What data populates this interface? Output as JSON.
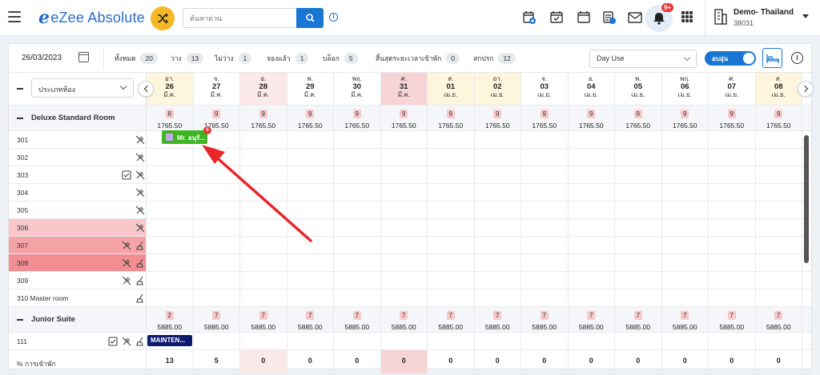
{
  "app": {
    "logo": "eZee Absolute",
    "search_placeholder": "ค้นหาด่วน",
    "notif_badge": "9+",
    "property_name": "Demo- Thailand",
    "property_code": "38031"
  },
  "filter": {
    "date": "26/03/2023",
    "stats": [
      {
        "label": "ทั้งหมด",
        "count": "20"
      },
      {
        "label": "ว่าง",
        "count": "13"
      },
      {
        "label": "ไม่ว่าง",
        "count": "1"
      },
      {
        "label": "จองแล้ว",
        "count": "1"
      },
      {
        "label": "บล็อก",
        "count": "5"
      },
      {
        "label": "สิ้นสุดระยะเวลาเข้าพัก",
        "count": "0"
      },
      {
        "label": "สกปรก",
        "count": "12"
      }
    ],
    "dayuse": "Day Use",
    "toggle_label": "อบอุ่น"
  },
  "grid": {
    "room_type_select": "ประเภทห้อง",
    "days": [
      {
        "dw": "อา.",
        "dn": "26",
        "dm": "มี.ค.",
        "bg": "#fdf5dc"
      },
      {
        "dw": "จ.",
        "dn": "27",
        "dm": "มี.ค.",
        "bg": "#ffffff"
      },
      {
        "dw": "อ.",
        "dn": "28",
        "dm": "มี.ค.",
        "bg": "#fbe9ea"
      },
      {
        "dw": "พ.",
        "dn": "29",
        "dm": "มี.ค.",
        "bg": "#ffffff"
      },
      {
        "dw": "พฤ.",
        "dn": "30",
        "dm": "มี.ค.",
        "bg": "#ffffff"
      },
      {
        "dw": "ศ.",
        "dn": "31",
        "dm": "มี.ค.",
        "bg": "#f7d4d6"
      },
      {
        "dw": "ส.",
        "dn": "01",
        "dm": "เม.ย.",
        "bg": "#fdf5dc"
      },
      {
        "dw": "อา.",
        "dn": "02",
        "dm": "เม.ย.",
        "bg": "#fdf5dc"
      },
      {
        "dw": "จ.",
        "dn": "03",
        "dm": "เม.ย.",
        "bg": "#ffffff"
      },
      {
        "dw": "อ.",
        "dn": "04",
        "dm": "เม.ย.",
        "bg": "#ffffff"
      },
      {
        "dw": "พ.",
        "dn": "05",
        "dm": "เม.ย.",
        "bg": "#ffffff"
      },
      {
        "dw": "พฤ.",
        "dn": "06",
        "dm": "เม.ย.",
        "bg": "#ffffff"
      },
      {
        "dw": "ศ.",
        "dn": "07",
        "dm": "เม.ย.",
        "bg": "#ffffff"
      },
      {
        "dw": "ส.",
        "dn": "08",
        "dm": "เม.ย.",
        "bg": "#fdf5dc"
      }
    ],
    "categories": [
      {
        "name": "Deluxe Standard Room",
        "avail": [
          "8",
          "9",
          "9",
          "9",
          "9",
          "9",
          "9",
          "9",
          "9",
          "9",
          "9",
          "9",
          "9",
          "9"
        ],
        "rates": [
          "1765.50",
          "1765.50",
          "1765.50",
          "1765.50",
          "1765.50",
          "1765.50",
          "1765.50",
          "1765.50",
          "1765.50",
          "1765.50",
          "1765.50",
          "1765.50",
          "1765.50",
          "1765.50"
        ],
        "rooms": [
          {
            "name": "301",
            "bg": "#ffffff",
            "icons": [
              "dirty"
            ]
          },
          {
            "name": "302",
            "bg": "#ffffff",
            "icons": [
              "dirty"
            ]
          },
          {
            "name": "303",
            "bg": "#ffffff",
            "icons": [
              "check",
              "dirty"
            ]
          },
          {
            "name": "304",
            "bg": "#ffffff",
            "icons": [
              "dirty"
            ]
          },
          {
            "name": "305",
            "bg": "#ffffff",
            "icons": [
              "dirty"
            ]
          },
          {
            "name": "306",
            "bg": "#f9c7c9",
            "icons": [
              "dirty"
            ]
          },
          {
            "name": "307",
            "bg": "#f6a3a6",
            "icons": [
              "dirty",
              "broom"
            ]
          },
          {
            "name": "308",
            "bg": "#f28e92",
            "icons": [
              "dirty",
              "broom"
            ]
          },
          {
            "name": "309",
            "bg": "#ffffff",
            "icons": [
              "dirty",
              "broom"
            ]
          },
          {
            "name": "310 Master room",
            "bg": "#ffffff",
            "icons": [
              "broom"
            ]
          }
        ]
      },
      {
        "name": "Junior Suite",
        "avail": [
          "2",
          "7",
          "7",
          "7",
          "7",
          "7",
          "7",
          "7",
          "7",
          "7",
          "7",
          "7",
          "7",
          "7"
        ],
        "rates": [
          "5885.00",
          "5885.00",
          "5885.00",
          "5885.00",
          "5885.00",
          "5885.00",
          "5885.00",
          "5885.00",
          "5885.00",
          "5885.00",
          "5885.00",
          "5885.00",
          "5885.00",
          "5885.00"
        ],
        "rooms": [
          {
            "name": "111",
            "bg": "#ffffff",
            "icons": [
              "check",
              "dirty",
              "broom"
            ]
          }
        ]
      }
    ],
    "booking": {
      "label": "Mr. อนุรั...",
      "badge": "5"
    },
    "maintenance": "MAINTEN...",
    "occupancy": {
      "label": "% การเข้าพัก",
      "values": [
        "13",
        "5",
        "0",
        "0",
        "0",
        "0",
        "0",
        "0",
        "0",
        "0",
        "0",
        "0",
        "0",
        "0"
      ]
    }
  }
}
